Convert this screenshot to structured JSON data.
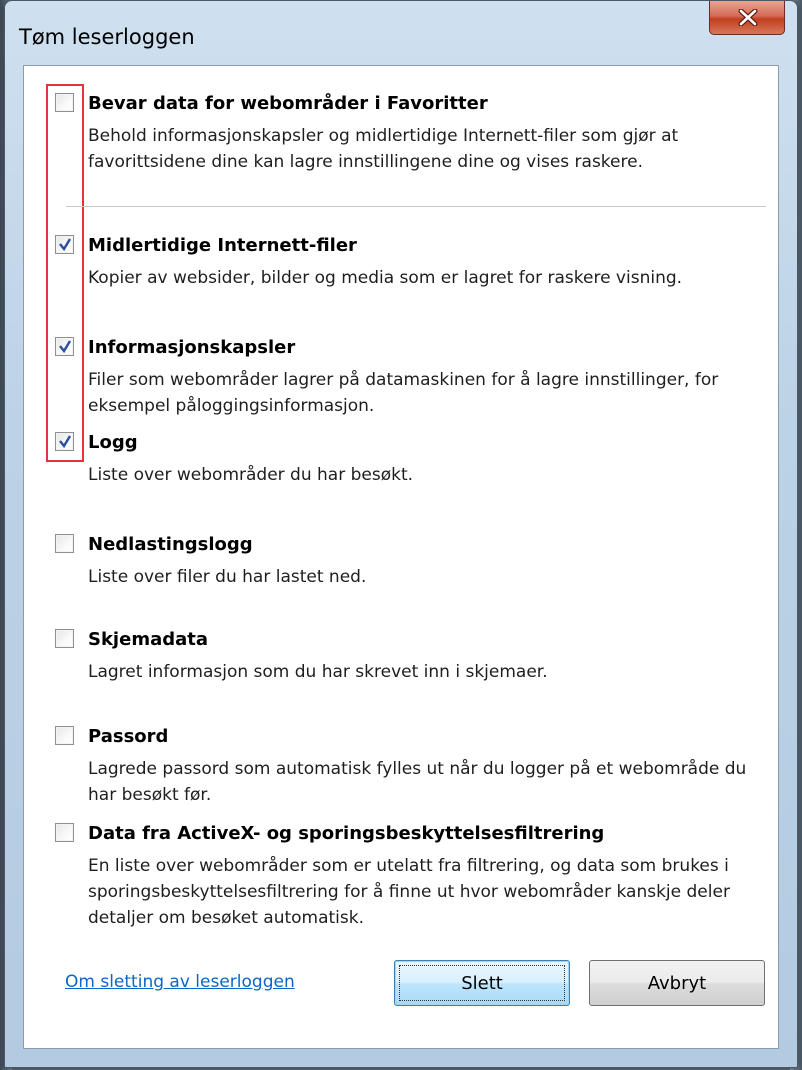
{
  "window": {
    "title": "Tøm leserloggen"
  },
  "options": [
    {
      "title": "Bevar data for webområder i Favoritter",
      "description": "Behold informasjonskapsler og midlertidige Internett-filer som gjør at favorittsidene dine kan lagre innstillingene dine og vises raskere.",
      "checked": false
    },
    {
      "title": "Midlertidige Internett-filer",
      "description": "Kopier av websider, bilder og media som er lagret for raskere visning.",
      "checked": true
    },
    {
      "title": "Informasjonskapsler",
      "description": "Filer som webområder lagrer på datamaskinen for å lagre innstillinger, for eksempel påloggingsinformasjon.",
      "checked": true
    },
    {
      "title": "Logg",
      "description": "Liste over webområder du har besøkt.",
      "checked": true
    },
    {
      "title": "Nedlastingslogg",
      "description": "Liste over filer du har lastet ned.",
      "checked": false
    },
    {
      "title": "Skjemadata",
      "description": "Lagret informasjon som du har skrevet inn i skjemaer.",
      "checked": false
    },
    {
      "title": "Passord",
      "description": "Lagrede passord som automatisk fylles ut når du logger på et webområde du har besøkt før.",
      "checked": false
    },
    {
      "title": "Data fra ActiveX- og sporingsbeskyttelsesfiltrering",
      "description": "En liste over webområder som er utelatt fra filtrering, og data som brukes i sporingsbeskyttelsesfiltrering for å finne ut hvor webområder kanskje deler detaljer om besøket automatisk.",
      "checked": false
    }
  ],
  "footer": {
    "link_text": "Om sletting av leserloggen",
    "delete_label": "Slett",
    "cancel_label": "Avbryt"
  },
  "colors": {
    "highlight_border": "#e8313b",
    "link": "#0a66c8",
    "close_button": "#c0401f",
    "check_mark": "#2b4e9e"
  },
  "icons": {
    "close": "close-icon",
    "check": "checkmark-icon"
  }
}
